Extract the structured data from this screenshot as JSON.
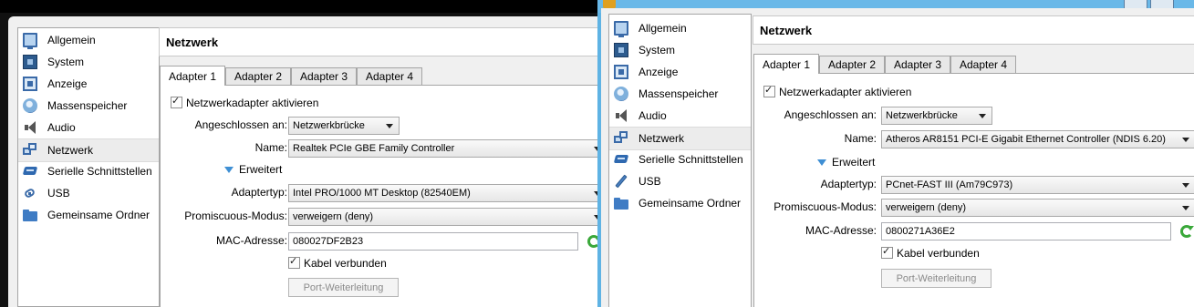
{
  "left": {
    "sidebar": [
      {
        "label": "Allgemein",
        "icon": "monitor-icon"
      },
      {
        "label": "System",
        "icon": "chip-icon"
      },
      {
        "label": "Anzeige",
        "icon": "display-icon"
      },
      {
        "label": "Massenspeicher",
        "icon": "disk-icon"
      },
      {
        "label": "Audio",
        "icon": "audio-icon"
      },
      {
        "label": "Netzwerk",
        "icon": "network-icon"
      },
      {
        "label": "Serielle Schnittstellen",
        "icon": "serial-icon"
      },
      {
        "label": "USB",
        "icon": "usb-icon"
      },
      {
        "label": "Gemeinsame Ordner",
        "icon": "folder-icon"
      }
    ],
    "selected": "Netzwerk",
    "heading": "Netzwerk",
    "tabs": [
      "Adapter 1",
      "Adapter 2",
      "Adapter 3",
      "Adapter 4"
    ],
    "active_tab": "Adapter 1",
    "form": {
      "enable_label": "Netzwerkadapter aktivieren",
      "enable_checked": true,
      "attached_label": "Angeschlossen an:",
      "attached_value": "Netzwerkbrücke",
      "name_label": "Name:",
      "name_value": "Realtek PCIe GBE Family Controller",
      "advanced_label": "Erweitert",
      "adapter_type_label": "Adaptertyp:",
      "adapter_type_value": "Intel PRO/1000 MT Desktop (82540EM)",
      "promisc_label": "Promiscuous-Modus:",
      "promisc_value": "verweigern (deny)",
      "mac_label": "MAC-Adresse:",
      "mac_value": "080027DF2B23",
      "cable_label": "Kabel verbunden",
      "cable_checked": true,
      "port_forward_label": "Port-Weiterleitung"
    }
  },
  "right": {
    "sidebar": [
      {
        "label": "Allgemein",
        "icon": "monitor-icon"
      },
      {
        "label": "System",
        "icon": "chip-icon"
      },
      {
        "label": "Anzeige",
        "icon": "display-icon"
      },
      {
        "label": "Massenspeicher",
        "icon": "disk-icon"
      },
      {
        "label": "Audio",
        "icon": "audio-icon"
      },
      {
        "label": "Netzwerk",
        "icon": "network-icon"
      },
      {
        "label": "Serielle Schnittstellen",
        "icon": "serial-icon"
      },
      {
        "label": "USB",
        "icon": "usb-icon"
      },
      {
        "label": "Gemeinsame Ordner",
        "icon": "folder-icon"
      }
    ],
    "selected": "Netzwerk",
    "heading": "Netzwerk",
    "tabs": [
      "Adapter 1",
      "Adapter 2",
      "Adapter 3",
      "Adapter 4"
    ],
    "active_tab": "Adapter 1",
    "form": {
      "enable_label": "Netzwerkadapter aktivieren",
      "enable_checked": true,
      "attached_label": "Angeschlossen an:",
      "attached_value": "Netzwerkbrücke",
      "name_label": "Name:",
      "name_value": "Atheros AR8151 PCI-E Gigabit Ethernet Controller (NDIS 6.20)",
      "advanced_label": "Erweitert",
      "adapter_type_label": "Adaptertyp:",
      "adapter_type_value": "PCnet-FAST III (Am79C973)",
      "promisc_label": "Promiscuous-Modus:",
      "promisc_value": "verweigern (deny)",
      "mac_label": "MAC-Adresse:",
      "mac_value": "0800271A36E2",
      "cable_label": "Kabel verbunden",
      "cable_checked": true,
      "port_forward_label": "Port-Weiterleitung"
    }
  }
}
